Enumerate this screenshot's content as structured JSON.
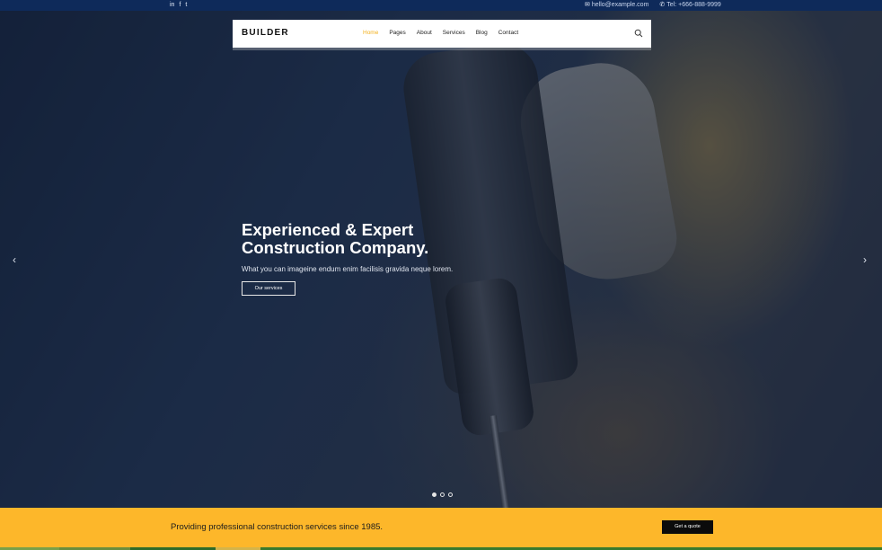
{
  "topbar": {
    "social": [
      {
        "icon": "linkedin-icon",
        "glyph": "in"
      },
      {
        "icon": "facebook-icon",
        "glyph": "f"
      },
      {
        "icon": "twitter-icon",
        "glyph": "t"
      }
    ],
    "email": "hello@example.com",
    "phone": "Tel: +666-888-9999"
  },
  "nav": {
    "logo": "BUILDER",
    "items": [
      "Home",
      "Pages",
      "About",
      "Services",
      "Blog",
      "Contact"
    ],
    "active": "Home"
  },
  "hero": {
    "title_line1": "Experienced & Expert",
    "title_line2": "Construction Company.",
    "subtitle": "What you can imageine endum enim facilisis gravida neque lorem.",
    "button": "Our services",
    "slides": 3,
    "current_slide": 1
  },
  "cta": {
    "text": "Providing professional construction services since 1985.",
    "button": "Get a quote"
  },
  "colors": {
    "topbar": "#0e2a5a",
    "accent": "#fdb72a",
    "active_link": "#f2b01e"
  }
}
